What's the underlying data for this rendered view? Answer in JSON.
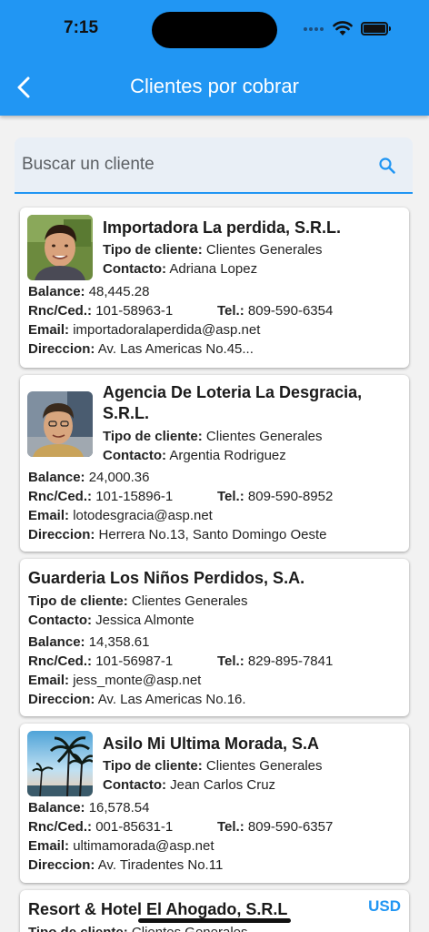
{
  "status_bar": {
    "time": "7:15"
  },
  "header": {
    "title": "Clientes por cobrar"
  },
  "search": {
    "placeholder": "Buscar un cliente"
  },
  "labels": {
    "tipo": "Tipo de cliente:",
    "contacto": "Contacto:",
    "balance": "Balance:",
    "rnc": "Rnc/Ced.:",
    "tel": "Tel.:",
    "email": "Email:",
    "direccion": "Direccion:"
  },
  "clients": [
    {
      "name": "Importadora La perdida, S.R.L.",
      "tipo": "Clientes Generales",
      "contacto": "Adriana Lopez",
      "balance": "48,445.28",
      "rnc": "101-58963-1",
      "tel": "809-590-6354",
      "email": "importadoralaperdida@asp.net",
      "direccion": "Av. Las Americas No.45..."
    },
    {
      "name_line1": "Agencia De Loteria La Desgracia,",
      "name_line2": "S.R.L.",
      "tipo": "Clientes Generales",
      "contacto": "Argentia Rodriguez",
      "balance": "24,000.36",
      "rnc": "101-15896-1",
      "tel": "809-590-8952",
      "email": "lotodesgracia@asp.net",
      "direccion": "Herrera No.13, Santo Domingo Oeste"
    },
    {
      "name": "Guarderia Los Niños Perdidos, S.A.",
      "tipo": "Clientes Generales",
      "contacto": "Jessica Almonte",
      "balance": "14,358.61",
      "rnc": "101-56987-1",
      "tel": "829-895-7841",
      "email": "jess_monte@asp.net",
      "direccion": "Av. Las Americas No.16."
    },
    {
      "name": "Asilo Mi Ultima Morada, S.A",
      "tipo": "Clientes Generales",
      "contacto": "Jean Carlos Cruz",
      "balance": "16,578.54",
      "rnc": "001-85631-1",
      "tel": "809-590-6357",
      "email": "ultimamorada@asp.net",
      "direccion": "Av. Tiradentes No.11"
    },
    {
      "name": "Resort & Hotel El Ahogado, S.R.L",
      "currency": "USD",
      "tipo": "Clientes Generales"
    }
  ],
  "colors": {
    "primary": "#2196f3",
    "background": "#f2f2f2",
    "card": "#ffffff",
    "search_bg": "#e9eff6"
  }
}
